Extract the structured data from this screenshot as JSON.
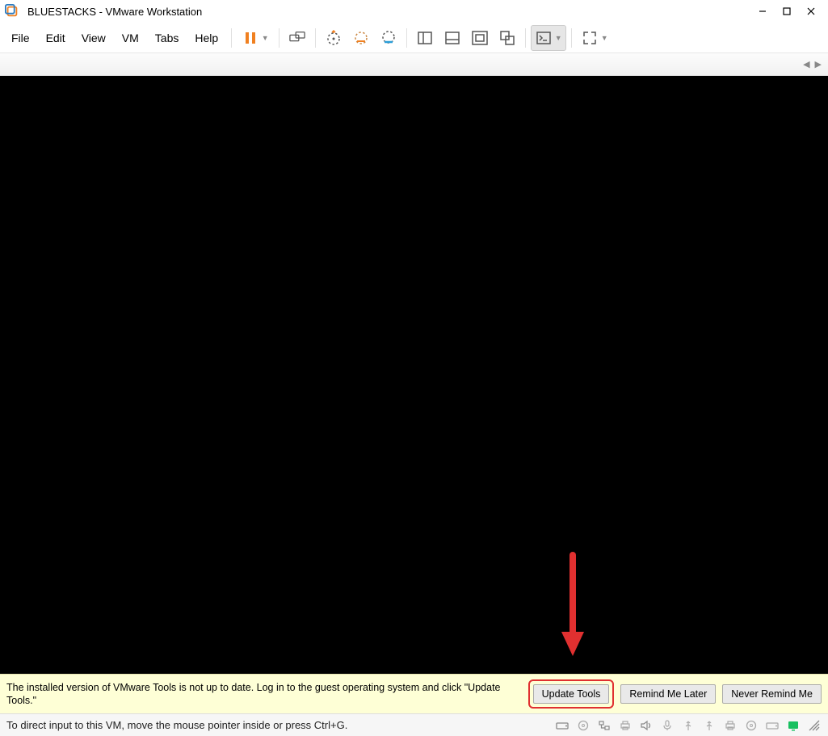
{
  "title": "BLUESTACKS - VMware Workstation",
  "menu": {
    "file": "File",
    "edit": "Edit",
    "view": "View",
    "vm": "VM",
    "tabs": "Tabs",
    "help": "Help"
  },
  "toolbar": {
    "suspend_icon": "pause-icon",
    "send_ctrlaltdel": "send-keys-icon",
    "snapshot_take": "snapshot-take-icon",
    "snapshot_revert": "snapshot-revert-icon",
    "snapshot_manage": "snapshot-manage-icon",
    "layout_sidebar": "layout-sidebar-icon",
    "layout_bottom": "layout-bottom-icon",
    "layout_fit": "layout-fit-icon",
    "layout_multi": "layout-multi-icon",
    "console": "console-icon",
    "fullscreen": "fullscreen-icon"
  },
  "infobar": {
    "message": "The installed version of VMware Tools is not up to date. Log in to the guest operating system and click \"Update Tools.\"",
    "update_btn": "Update Tools",
    "remind_btn": "Remind Me Later",
    "never_btn": "Never Remind Me"
  },
  "statusbar": {
    "hint": "To direct input to this VM, move the mouse pointer inside or press Ctrl+G."
  },
  "colors": {
    "accent": "#f08020",
    "annotation": "#e03030",
    "info_bg": "#feffd6",
    "tray_connected": "#18c060"
  }
}
